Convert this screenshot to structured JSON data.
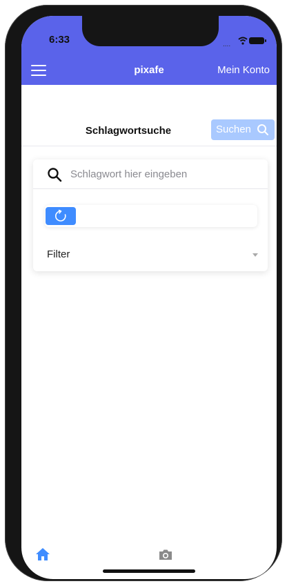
{
  "status_bar": {
    "time": "6:33"
  },
  "header": {
    "title": "pixafe",
    "account_label": "Mein Konto",
    "menu_icon": "hamburger-menu-icon",
    "background_color": "#5a63ea"
  },
  "search": {
    "title": "Schlagwortsuche",
    "button_label": "Suchen",
    "button_icon": "search-icon",
    "input_placeholder": "Schlagwort hier eingeben",
    "input_value": "",
    "refresh_icon": "refresh-icon",
    "filter_label": "Filter",
    "accent_color": "#3f8cff",
    "button_color": "#a9c9ff"
  },
  "tabbar": {
    "items": [
      {
        "icon": "home-icon",
        "active": true,
        "color": "#3f8cff"
      },
      {
        "icon": "camera-icon",
        "active": false,
        "color": "#888888"
      }
    ]
  }
}
